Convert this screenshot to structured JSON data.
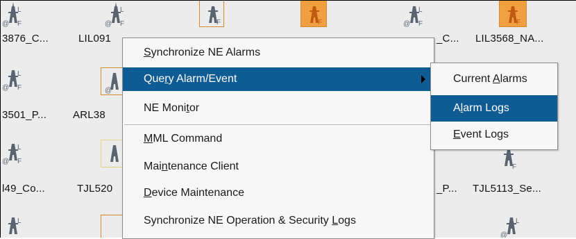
{
  "canvas": {
    "row1": [
      "3876_C...",
      "LIL091",
      "_C...",
      "LIL3568_NA..."
    ],
    "row2": [
      "3501_P...",
      "ARL38"
    ],
    "row3": [
      "l49_Co...",
      "TJL520",
      "_P...",
      "TJL5113_Se..."
    ]
  },
  "context_menu": {
    "items": [
      {
        "before": "",
        "mnemonic": "S",
        "after": "ynchronize NE Alarms"
      },
      {
        "before": "Que",
        "mnemonic": "r",
        "after": "y Alarm/Event"
      },
      {
        "before": "NE Moni",
        "mnemonic": "t",
        "after": "or"
      },
      {
        "before": "",
        "mnemonic": "M",
        "after": "ML Command"
      },
      {
        "before": "Mai",
        "mnemonic": "n",
        "after": "tenance Client"
      },
      {
        "before": "",
        "mnemonic": "D",
        "after": "evice Maintenance"
      },
      {
        "before": "Synchronize NE Operation & Security ",
        "mnemonic": "L",
        "after": "ogs"
      }
    ]
  },
  "submenu": {
    "items": [
      {
        "before": "Current ",
        "mnemonic": "A",
        "after": "larms"
      },
      {
        "before": "A",
        "mnemonic": "l",
        "after": "arm Logs"
      },
      {
        "before": "",
        "mnemonic": "E",
        "after": "vent Logs"
      }
    ]
  },
  "icons": {
    "ne_tower_gray": "ne-tower-icon",
    "ne_tower_orange": "ne-tower-alarm-icon"
  },
  "colors": {
    "highlight": "#0f5b93",
    "alarm_orange": "#d38a2e",
    "icon_gray": "#5a6470"
  }
}
